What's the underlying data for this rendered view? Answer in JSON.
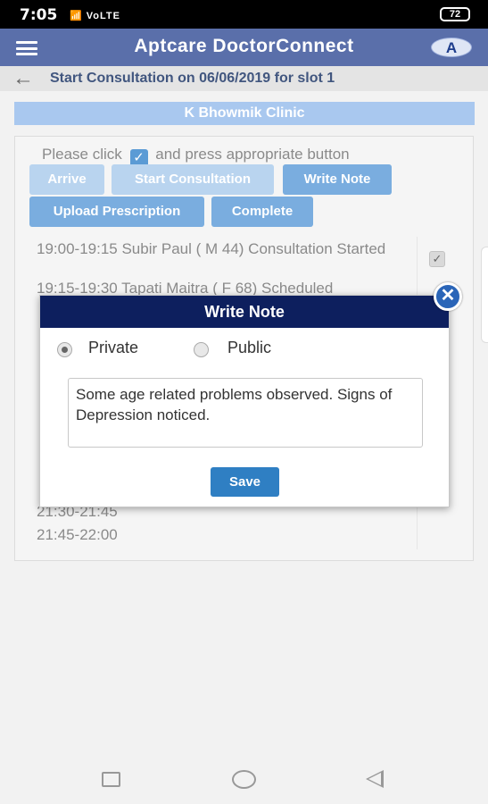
{
  "status_bar": {
    "time": "7:05",
    "signal": "📶 VoLTE",
    "battery": "72"
  },
  "header": {
    "title": "Aptcare DoctorConnect",
    "logo_letter": "A"
  },
  "subheader": {
    "title": "Start Consultation on 06/06/2019 for slot 1"
  },
  "clinic": {
    "name": "K Bhowmik Clinic"
  },
  "panel": {
    "instruction_before": "Please click",
    "instruction_after": "and press appropriate button",
    "buttons": {
      "arrive": "Arrive",
      "start_consultation": "Start Consultation",
      "write_note": "Write Note",
      "upload_prescription": "Upload Prescription",
      "complete": "Complete"
    },
    "slots": [
      "19:00-19:15 Subir Paul ( M 44) Consultation Started",
      "19:15-19:30 Tapati Maitra ( F 68) Scheduled",
      "21:30-21:45",
      "21:45-22:00"
    ]
  },
  "dialog": {
    "title": "Write Note",
    "options": {
      "private": "Private",
      "public": "Public"
    },
    "selected_option": "Private",
    "note_text": "Some age related problems observed. Signs of Depression noticed.",
    "save_label": "Save",
    "close_symbol": "✕"
  },
  "colors": {
    "app_header": "#5a6faa",
    "dialog_header": "#0d1f5e",
    "active_button": "#7aaddf",
    "save_button": "#2f7fc3"
  }
}
